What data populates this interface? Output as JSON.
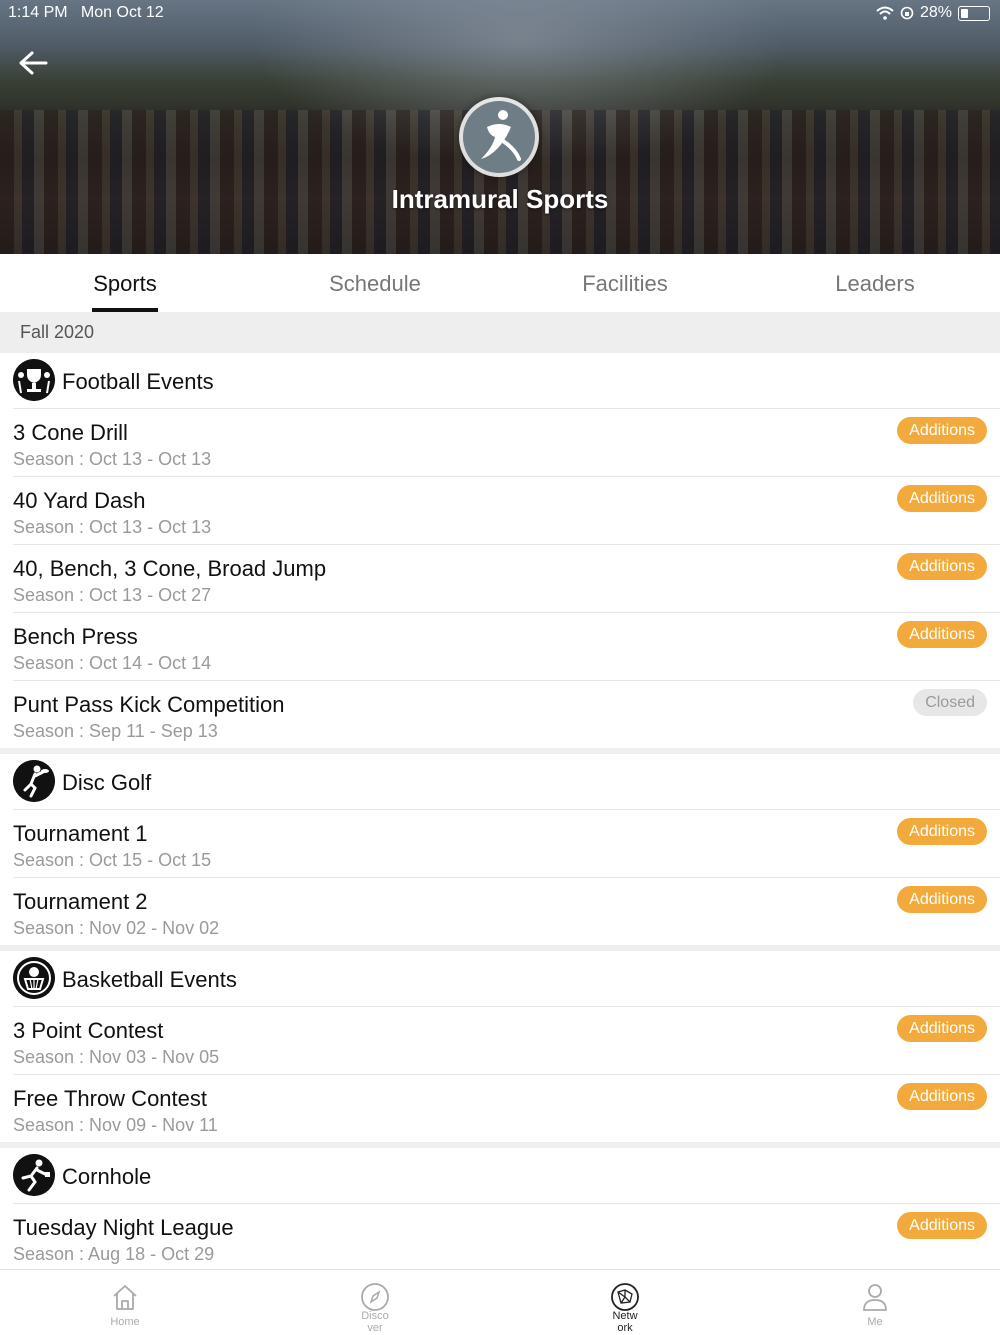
{
  "status": {
    "time": "1:14 PM   Mon Oct 12",
    "battery": "28%"
  },
  "header": {
    "title": "Intramural Sports"
  },
  "tabs": [
    {
      "label": "Sports",
      "active": true
    },
    {
      "label": "Schedule",
      "active": false
    },
    {
      "label": "Facilities",
      "active": false
    },
    {
      "label": "Leaders",
      "active": false
    }
  ],
  "season_label": "Fall 2020",
  "groups": [
    {
      "name": "Football Events",
      "icon": "football-trophy-icon",
      "events": [
        {
          "name": "3 Cone Drill",
          "season": "Season : Oct 13 - Oct 13",
          "status": "Additions"
        },
        {
          "name": "40 Yard Dash",
          "season": "Season : Oct 13 - Oct 13",
          "status": "Additions"
        },
        {
          "name": "40, Bench, 3 Cone, Broad Jump",
          "season": "Season : Oct 13 - Oct 27",
          "status": "Additions"
        },
        {
          "name": "Bench Press",
          "season": "Season : Oct 14 - Oct 14",
          "status": "Additions"
        },
        {
          "name": "Punt Pass Kick Competition",
          "season": "Season : Sep 11 - Sep 13",
          "status": "Closed"
        }
      ]
    },
    {
      "name": "Disc Golf",
      "icon": "disc-golf-icon",
      "events": [
        {
          "name": "Tournament 1",
          "season": "Season : Oct 15 - Oct 15",
          "status": "Additions"
        },
        {
          "name": "Tournament 2",
          "season": "Season : Nov 02 - Nov 02",
          "status": "Additions"
        }
      ]
    },
    {
      "name": "Basketball Events",
      "icon": "basketball-hoop-icon",
      "events": [
        {
          "name": "3 Point Contest",
          "season": "Season : Nov 03 - Nov 05",
          "status": "Additions"
        },
        {
          "name": "Free Throw Contest",
          "season": "Season : Nov 09 - Nov 11",
          "status": "Additions"
        }
      ]
    },
    {
      "name": "Cornhole",
      "icon": "cornhole-icon",
      "events": [
        {
          "name": "Tuesday Night League",
          "season": "Season : Aug 18 - Oct 29",
          "status": "Additions"
        }
      ]
    }
  ],
  "bottom_nav": [
    {
      "label": "Home",
      "icon": "home-icon"
    },
    {
      "label": "Disco\nver",
      "icon": "compass-icon"
    },
    {
      "label": "Netw\nork",
      "icon": "network-icon"
    },
    {
      "label": "Me",
      "icon": "person-icon"
    }
  ],
  "colors": {
    "accent": "#f2aa3c",
    "closed_bg": "#e7e7e7"
  }
}
